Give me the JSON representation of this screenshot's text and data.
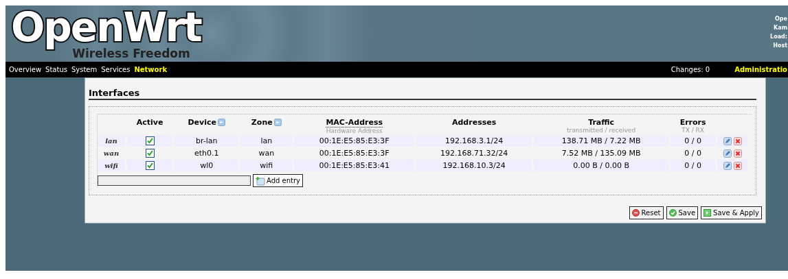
{
  "header": {
    "logo_title": "OpenWrt",
    "logo_subtitle": "Wireless Freedom",
    "info_lines": [
      "Ope",
      "Kam",
      "Load:",
      "Host"
    ]
  },
  "nav": {
    "items": [
      {
        "label": "Overview",
        "selected": false
      },
      {
        "label": "Status",
        "selected": false
      },
      {
        "label": "System",
        "selected": false
      },
      {
        "label": "Services",
        "selected": false
      },
      {
        "label": "Network",
        "selected": true
      }
    ],
    "changes": "Changes: 0",
    "admin": "Administratio"
  },
  "section": {
    "title": "Interfaces"
  },
  "table": {
    "columns": [
      {
        "label": "Active"
      },
      {
        "label": "Device",
        "sortable": true
      },
      {
        "label": "Zone",
        "sortable": true
      },
      {
        "label": "MAC-Address",
        "hint": "Hardware Address"
      },
      {
        "label": "Addresses"
      },
      {
        "label": "Traffic",
        "hint": "transmitted / received"
      },
      {
        "label": "Errors",
        "hint": "TX / RX"
      }
    ],
    "rows": [
      {
        "name": "lan",
        "active": true,
        "device": "br-lan",
        "zone": "lan",
        "mac": "00:1E:E5:85:E3:3F",
        "addresses": "192.168.3.1/24",
        "traffic": "138.71 MB / 7.22 MB",
        "errors": "0 / 0"
      },
      {
        "name": "wan",
        "active": true,
        "device": "eth0.1",
        "zone": "wan",
        "mac": "00:1E:E5:85:E3:3F",
        "addresses": "192.168.71.32/24",
        "traffic": "7.52 MB / 135.09 MB",
        "errors": "0 / 0"
      },
      {
        "name": "wifi",
        "active": true,
        "device": "wl0",
        "zone": "wifi",
        "mac": "00:1E:E5:85:E3:41",
        "addresses": "192.168.10.3/24",
        "traffic": "0.00 B / 0.00 B",
        "errors": "0 / 0"
      }
    ]
  },
  "add_button": "Add entry",
  "buttons": [
    {
      "kind": "reset",
      "label": "Reset"
    },
    {
      "kind": "save",
      "label": "Save"
    },
    {
      "kind": "apply",
      "label": "Save & Apply"
    }
  ]
}
